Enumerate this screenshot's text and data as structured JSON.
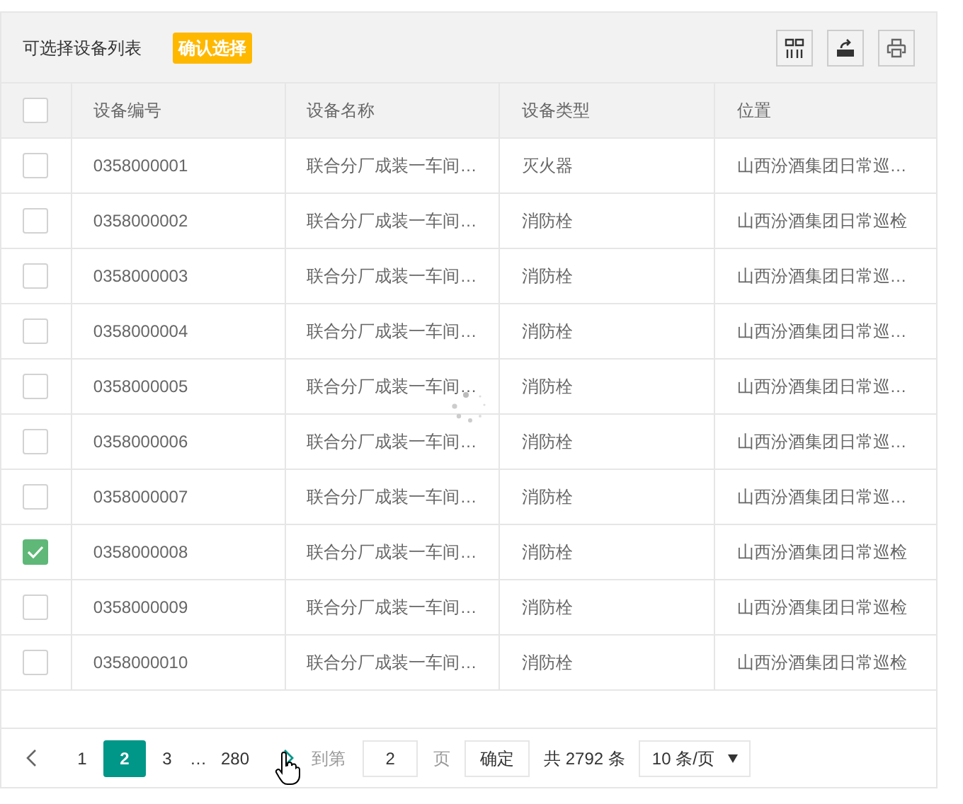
{
  "toolbar": {
    "title": "可选择设备列表",
    "confirm_button": "确认选择"
  },
  "table": {
    "header_checked": false,
    "columns": [
      "设备编号",
      "设备名称",
      "设备类型",
      "位置"
    ],
    "rows": [
      {
        "checked": false,
        "cells": [
          "0358000001",
          "联合分厂成装一车间…",
          "灭火器",
          "山西汾酒集团日常巡…"
        ]
      },
      {
        "checked": false,
        "cells": [
          "0358000002",
          "联合分厂成装一车间…",
          "消防栓",
          "山西汾酒集团日常巡检"
        ]
      },
      {
        "checked": false,
        "cells": [
          "0358000003",
          "联合分厂成装一车间…",
          "消防栓",
          "山西汾酒集团日常巡…"
        ]
      },
      {
        "checked": false,
        "cells": [
          "0358000004",
          "联合分厂成装一车间…",
          "消防栓",
          "山西汾酒集团日常巡…"
        ]
      },
      {
        "checked": false,
        "cells": [
          "0358000005",
          "联合分厂成装一车间…",
          "消防栓",
          "山西汾酒集团日常巡…"
        ]
      },
      {
        "checked": false,
        "cells": [
          "0358000006",
          "联合分厂成装一车间…",
          "消防栓",
          "山西汾酒集团日常巡…"
        ]
      },
      {
        "checked": false,
        "cells": [
          "0358000007",
          "联合分厂成装一车间…",
          "消防栓",
          "山西汾酒集团日常巡…"
        ]
      },
      {
        "checked": true,
        "cells": [
          "0358000008",
          "联合分厂成装一车间…",
          "消防栓",
          "山西汾酒集团日常巡检"
        ]
      },
      {
        "checked": false,
        "cells": [
          "0358000009",
          "联合分厂成装一车间…",
          "消防栓",
          "山西汾酒集团日常巡检"
        ]
      },
      {
        "checked": false,
        "cells": [
          "0358000010",
          "联合分厂成装一车间…",
          "消防栓",
          "山西汾酒集团日常巡检"
        ]
      }
    ]
  },
  "pagination": {
    "pages": [
      {
        "label": "1",
        "selected": false,
        "kind": "page"
      },
      {
        "label": "2",
        "selected": true,
        "kind": "page"
      },
      {
        "label": "3",
        "selected": false,
        "kind": "page"
      },
      {
        "label": "…",
        "kind": "ellipsis"
      },
      {
        "label": "280",
        "selected": false,
        "kind": "page"
      }
    ],
    "goto_label": "到第",
    "goto_value": "2",
    "page_unit": "页",
    "confirm": "确定",
    "total": "共 2792 条",
    "page_size": "10 条/页"
  }
}
